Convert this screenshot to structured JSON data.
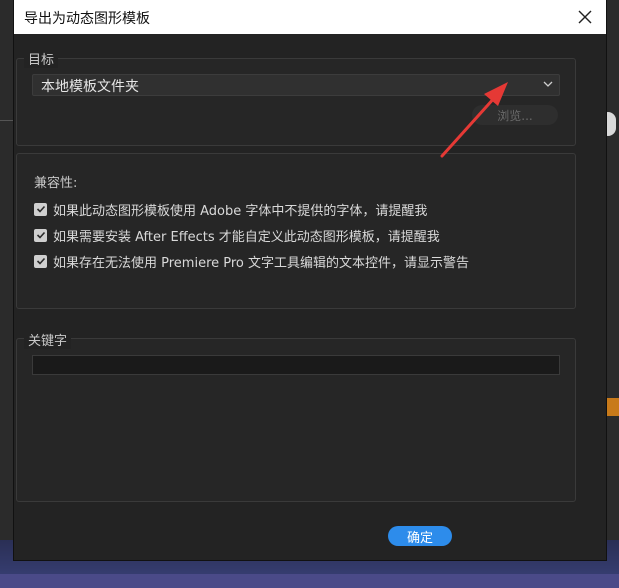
{
  "dialog": {
    "title": "导出为动态图形模板",
    "close_icon": "close-icon"
  },
  "target": {
    "label": "目标",
    "selected": "本地模板文件夹",
    "browse_label": "浏览..."
  },
  "compat": {
    "title": "兼容性:",
    "options": [
      {
        "label": "如果此动态图形模板使用 Adobe 字体中不提供的字体，请提醒我",
        "checked": true
      },
      {
        "label": "如果需要安装 After Effects 才能自定义此动态图形模板，请提醒我",
        "checked": true
      },
      {
        "label": "如果存在无法使用 Premiere Pro 文字工具编辑的文本控件，请显示警告",
        "checked": true
      }
    ]
  },
  "keyword": {
    "label": "关键字",
    "value": ""
  },
  "footer": {
    "ok_label": "确定"
  },
  "colors": {
    "accent": "#2d8ceb",
    "annotation_arrow": "#e53935"
  }
}
